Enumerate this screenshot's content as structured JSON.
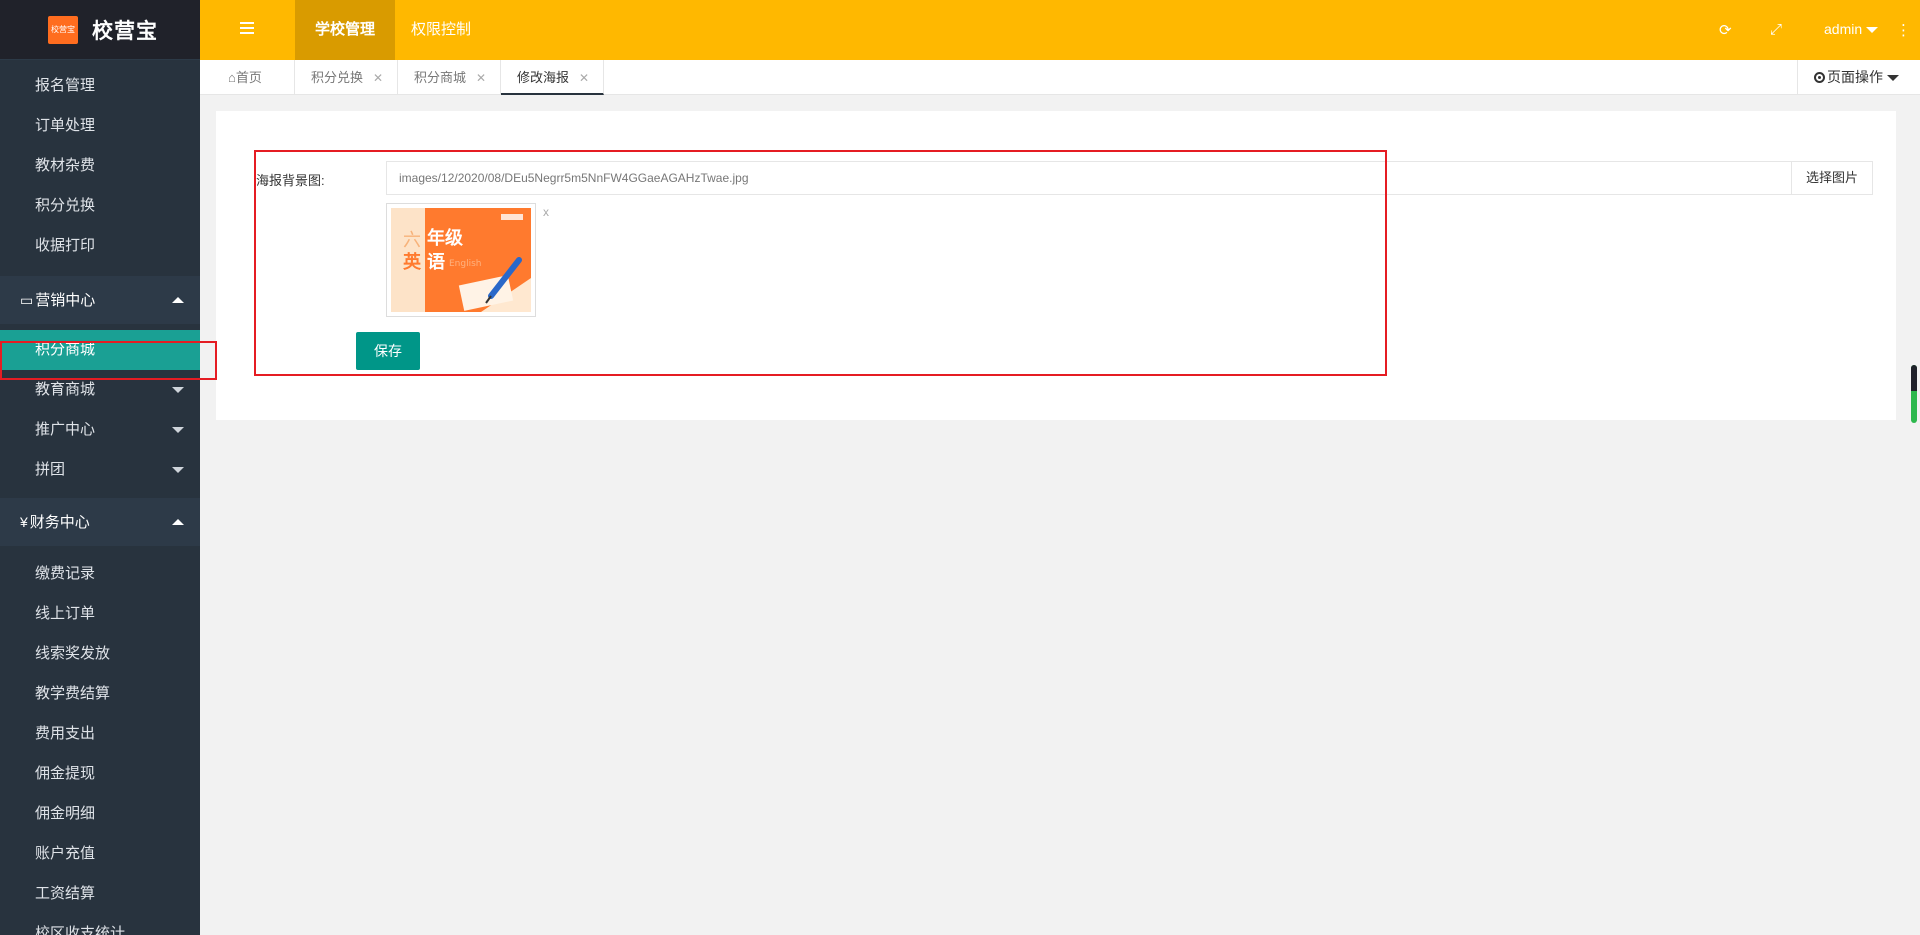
{
  "app": {
    "logo_badge": "校营宝",
    "name": "校营宝"
  },
  "header": {
    "tabs": [
      {
        "label": "学校管理"
      },
      {
        "label": "权限控制"
      }
    ],
    "refresh_icon": "refresh-icon",
    "fullscreen_icon": "fullscreen-icon",
    "user": "admin",
    "more_icon": "more-vertical-icon"
  },
  "sidebar": {
    "top_items": [
      "报名管理",
      "订单处理",
      "教材杂费",
      "积分兑换",
      "收据打印"
    ],
    "groups": [
      {
        "icon": "▭",
        "label": "营销中心"
      },
      {
        "icon": "¥",
        "label": "财务中心"
      }
    ],
    "marketing_items": [
      "积分商城",
      "教育商城",
      "推广中心",
      "拼团"
    ],
    "finance_items": [
      "缴费记录",
      "线上订单",
      "线索奖发放",
      "教学费结算",
      "费用支出",
      "佣金提现",
      "佣金明细",
      "账户充值",
      "工资结算",
      "校区收支统计"
    ]
  },
  "page_tabs": [
    {
      "label": "首页",
      "closable": false
    },
    {
      "label": "积分兑换",
      "closable": true
    },
    {
      "label": "积分商城",
      "closable": true
    },
    {
      "label": "修改海报",
      "closable": true
    }
  ],
  "page_ops": "页面操作",
  "form": {
    "label": "海报背景图:",
    "value": "images/12/2020/08/DEu5Negrr5m5NnFW4GGaeAGAHzTwae.jpg",
    "pick_button": "选择图片",
    "remove_label": "x",
    "save_button": "保存"
  },
  "poster": {
    "tag": "六",
    "line1": "年级",
    "line2a": "英",
    "line2b": "语",
    "english": "English"
  },
  "colors": {
    "header": "#ffb800",
    "sidebar": "#28333e",
    "active": "#1aa094",
    "primary": "#009688",
    "highlight": "#e51c23"
  }
}
